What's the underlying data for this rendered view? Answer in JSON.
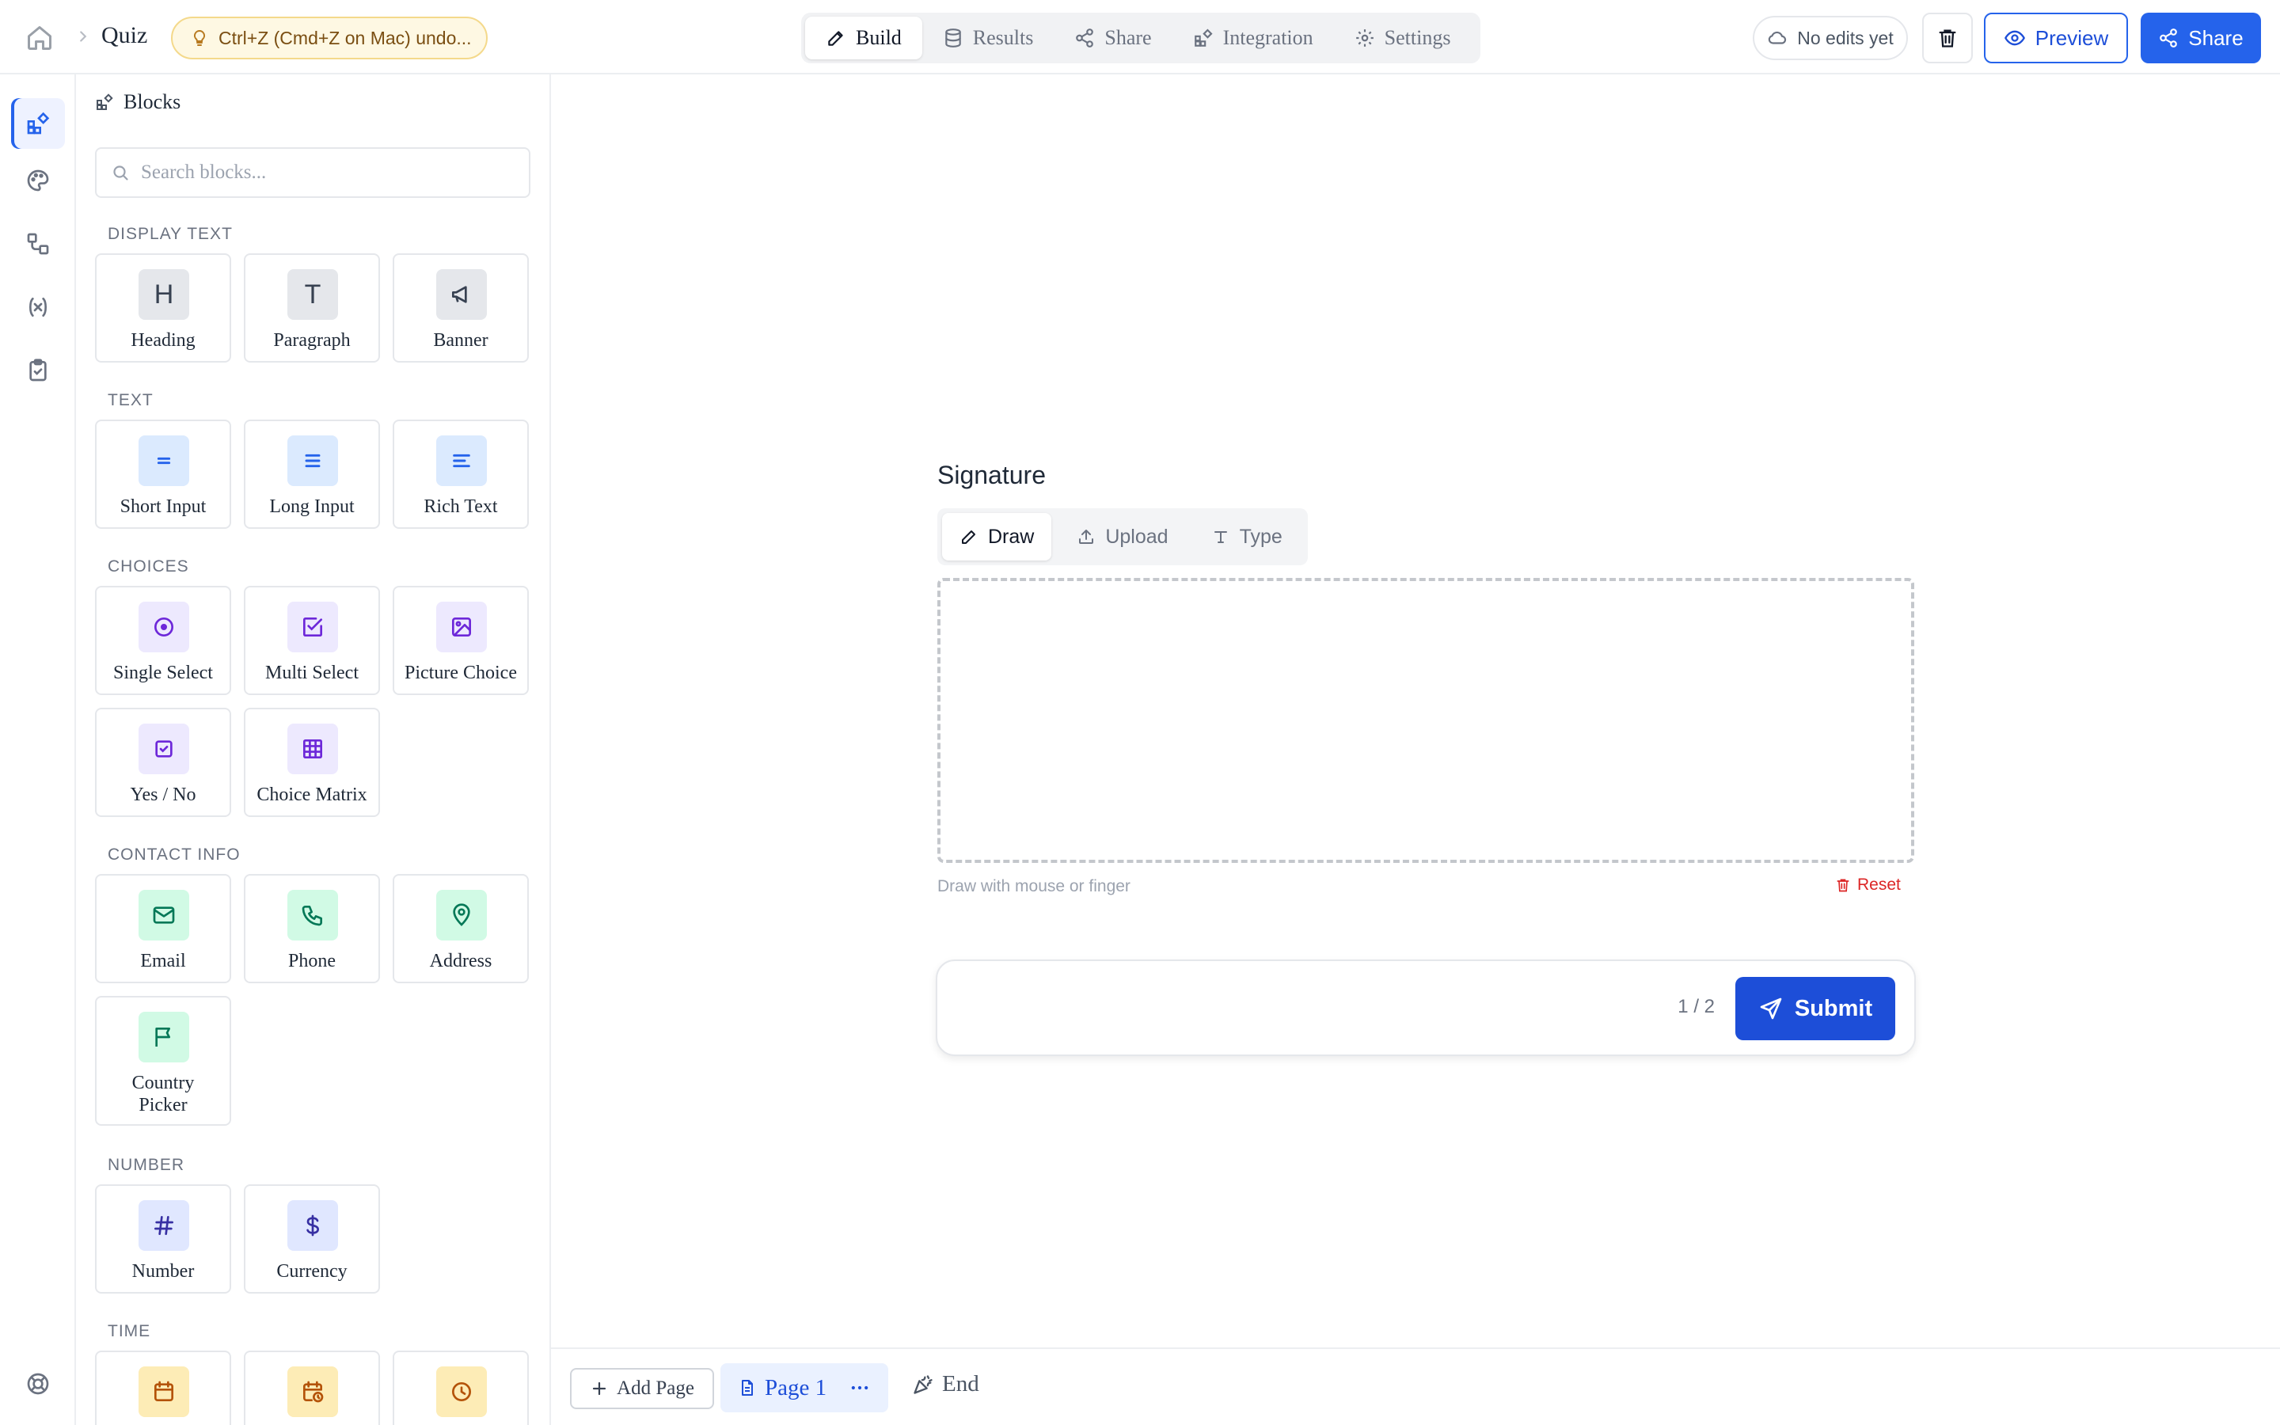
{
  "header": {
    "breadcrumb_title": "Quiz",
    "undo_tip": "Ctrl+Z (Cmd+Z on Mac) undo...",
    "tabs": [
      {
        "label": "Build",
        "icon": "pencil-icon",
        "active": true
      },
      {
        "label": "Results",
        "icon": "database-icon",
        "active": false
      },
      {
        "label": "Share",
        "icon": "share-icon",
        "active": false
      },
      {
        "label": "Integration",
        "icon": "blocks-icon",
        "active": false
      },
      {
        "label": "Settings",
        "icon": "gear-icon",
        "active": false
      }
    ],
    "save_status": "No edits yet",
    "preview_label": "Preview",
    "share_label": "Share"
  },
  "rail": {
    "items": [
      "blocks-icon",
      "palette-icon",
      "workflow-icon",
      "variable-icon",
      "clipboard-check-icon",
      "help-buoy-icon"
    ],
    "active_index": 0
  },
  "panel": {
    "title": "Blocks",
    "search_placeholder": "Search blocks...",
    "sections": [
      {
        "label": "DISPLAY TEXT",
        "items": [
          {
            "label": "Heading",
            "icon": "heading-icon"
          },
          {
            "label": "Paragraph",
            "icon": "paragraph-icon"
          },
          {
            "label": "Banner",
            "icon": "megaphone-icon"
          }
        ]
      },
      {
        "label": "TEXT",
        "items": [
          {
            "label": "Short Input",
            "icon": "short-input-icon"
          },
          {
            "label": "Long Input",
            "icon": "long-input-icon"
          },
          {
            "label": "Rich Text",
            "icon": "rich-text-icon"
          }
        ]
      },
      {
        "label": "CHOICES",
        "items": [
          {
            "label": "Single Select",
            "icon": "radio-icon"
          },
          {
            "label": "Multi Select",
            "icon": "checkbox-icon"
          },
          {
            "label": "Picture Choice",
            "icon": "image-icon"
          },
          {
            "label": "Yes / No",
            "icon": "check-square-icon"
          },
          {
            "label": "Choice Matrix",
            "icon": "grid-icon"
          }
        ]
      },
      {
        "label": "CONTACT INFO",
        "items": [
          {
            "label": "Email",
            "icon": "mail-icon"
          },
          {
            "label": "Phone",
            "icon": "phone-icon"
          },
          {
            "label": "Address",
            "icon": "map-pin-icon"
          },
          {
            "label": "Country Picker",
            "icon": "flag-icon"
          }
        ]
      },
      {
        "label": "NUMBER",
        "items": [
          {
            "label": "Number",
            "icon": "hash-icon"
          },
          {
            "label": "Currency",
            "icon": "dollar-icon"
          }
        ]
      },
      {
        "label": "TIME",
        "items": [
          {
            "label": "",
            "icon": "calendar-icon"
          },
          {
            "label": "",
            "icon": "calendar-clock-icon"
          },
          {
            "label": "",
            "icon": "clock-icon"
          }
        ]
      }
    ]
  },
  "canvas": {
    "signature": {
      "title": "Signature",
      "modes": [
        {
          "label": "Draw",
          "icon": "pencil-icon",
          "active": true
        },
        {
          "label": "Upload",
          "icon": "upload-icon",
          "active": false
        },
        {
          "label": "Type",
          "icon": "type-icon",
          "active": false
        }
      ],
      "hint": "Draw with mouse or finger",
      "reset_label": "Reset"
    },
    "footer": {
      "page_count": "1 / 2",
      "submit_label": "Submit"
    }
  },
  "pagebar": {
    "add_page_label": "Add Page",
    "pages": [
      {
        "label": "Page 1",
        "active": true
      }
    ],
    "end_label": "End"
  },
  "colors": {
    "accent": "#2563eb",
    "accent_dark": "#1d4ed8",
    "danger": "#dc2626",
    "tip_bg": "#fef8e3"
  }
}
